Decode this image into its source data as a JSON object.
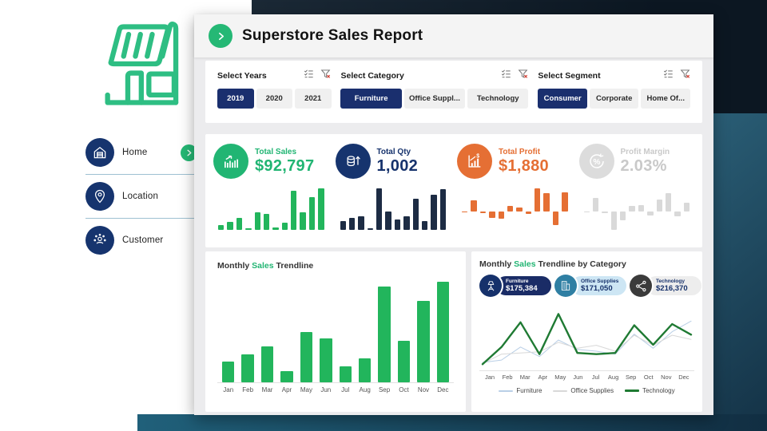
{
  "header": {
    "title": "Superstore Sales Report"
  },
  "sidebar": {
    "items": [
      {
        "label": "Home",
        "icon": "home",
        "active": true
      },
      {
        "label": "Location",
        "icon": "location",
        "active": false
      },
      {
        "label": "Customer",
        "icon": "customer",
        "active": false
      }
    ]
  },
  "filters": [
    {
      "label": "Select Years",
      "options": [
        {
          "label": "2019",
          "selected": true
        },
        {
          "label": "2020",
          "selected": false
        },
        {
          "label": "2021",
          "selected": false
        }
      ]
    },
    {
      "label": "Select Category",
      "options": [
        {
          "label": "Furniture",
          "selected": true
        },
        {
          "label": "Office Suppl...",
          "selected": false
        },
        {
          "label": "Technology",
          "selected": false
        }
      ]
    },
    {
      "label": "Select Segment",
      "options": [
        {
          "label": "Consumer",
          "selected": true
        },
        {
          "label": "Corporate",
          "selected": false
        },
        {
          "label": "Home Of...",
          "selected": false
        }
      ]
    }
  ],
  "kpis": [
    {
      "label": "Total Sales",
      "value": "$92,797",
      "icon": "trend-chart",
      "circle_color": "#21B573",
      "text_color": "#21B573",
      "spark_color": "#22B55C",
      "spark_type": "positive",
      "spark_key": "sales_spark"
    },
    {
      "label": "Total Qty",
      "value": "1,002",
      "icon": "coins",
      "circle_color": "#16346E",
      "text_color": "#16326C",
      "spark_color": "#1D2C44",
      "spark_type": "positive",
      "spark_key": "qty_spark"
    },
    {
      "label": "Total Profit",
      "value": "$1,880",
      "icon": "profit-chart",
      "circle_color": "#E56F34",
      "text_color": "#E56F34",
      "spark_color": "#E56F34",
      "spark_type": "signed",
      "spark_key": "profit_spark"
    },
    {
      "label": "Profit Margin",
      "value": "2.03%",
      "icon": "percent",
      "circle_color": "#DCDCDC",
      "text_color": "#C9C9C9",
      "spark_color": "#D9D9D9",
      "spark_type": "signed",
      "spark_key": "margin_spark"
    }
  ],
  "category_cards": [
    {
      "name": "Furniture",
      "value": "$175,384",
      "icon": "lamp",
      "circle_color": "#16316B",
      "pill_color": "#1A2C66",
      "text_color": "#FFFFFF"
    },
    {
      "name": "Office Supplies",
      "value": "$171,050",
      "icon": "building",
      "circle_color": "#2F7FA3",
      "pill_color": "#CDE6F4",
      "text_color": "#16316B"
    },
    {
      "name": "Technology",
      "value": "$216,370",
      "icon": "share",
      "circle_color": "#3B3B3B",
      "pill_color": "#EDEDED",
      "text_color": "#16316B"
    }
  ],
  "chart_data": [
    {
      "id": "sales_spark",
      "type": "bar",
      "title": "Total Sales by month (sparkline)",
      "units": "relative_0_100",
      "categories": [
        "Jan",
        "Feb",
        "Mar",
        "Apr",
        "May",
        "Jun",
        "Jul",
        "Aug",
        "Sep",
        "Oct",
        "Nov",
        "Dec"
      ],
      "values": [
        12,
        20,
        28,
        4,
        42,
        38,
        5,
        18,
        95,
        42,
        78,
        100
      ]
    },
    {
      "id": "qty_spark",
      "type": "bar",
      "title": "Total Qty by month (sparkline)",
      "units": "relative_0_100",
      "categories": [
        "Jan",
        "Feb",
        "Mar",
        "Apr",
        "May",
        "Jun",
        "Jul",
        "Aug",
        "Sep",
        "Oct",
        "Nov",
        "Dec"
      ],
      "values": [
        22,
        28,
        32,
        4,
        100,
        45,
        25,
        33,
        75,
        22,
        85,
        98
      ]
    },
    {
      "id": "profit_spark",
      "type": "bar",
      "title": "Total Profit by month (sparkline, signed)",
      "units": "relative_-100_100",
      "categories": [
        "Jan",
        "Feb",
        "Mar",
        "Apr",
        "May",
        "Jun",
        "Jul",
        "Aug",
        "Sep",
        "Oct",
        "Nov",
        "Dec"
      ],
      "values": [
        -4,
        35,
        -8,
        -28,
        -30,
        18,
        12,
        -10,
        75,
        60,
        -55,
        62
      ]
    },
    {
      "id": "margin_spark",
      "type": "bar",
      "title": "Profit Margin by month (sparkline, signed)",
      "units": "relative_-100_100",
      "categories": [
        "Jan",
        "Feb",
        "Mar",
        "Apr",
        "May",
        "Jun",
        "Jul",
        "Aug",
        "Sep",
        "Oct",
        "Nov",
        "Dec"
      ],
      "values": [
        -5,
        40,
        -8,
        -70,
        -35,
        15,
        18,
        -15,
        35,
        55,
        -20,
        25
      ]
    },
    {
      "id": "monthly_sales_trendline",
      "type": "bar",
      "title": "Monthly Sales Trendline",
      "title_prefix": "Monthly ",
      "title_accent": "Sales",
      "title_suffix": " Trendline",
      "xlabel": "Month",
      "ylabel": "Sales",
      "units": "relative_0_100",
      "grid": false,
      "categories": [
        "Jan",
        "Feb",
        "Mar",
        "Apr",
        "May",
        "Jun",
        "Jul",
        "Aug",
        "Sep",
        "Oct",
        "Nov",
        "Dec"
      ],
      "values": [
        21,
        28,
        36,
        11,
        50,
        44,
        16,
        24,
        95,
        41,
        81,
        100
      ],
      "bar_color": "#22B55C"
    },
    {
      "id": "monthly_sales_by_category",
      "type": "line",
      "title": "Monthly Sales Trendline by Category",
      "title_prefix": "Monthly ",
      "title_accent": "Sales",
      "title_suffix": " Trendline by Category",
      "xlabel": "Month",
      "ylabel": "Sales",
      "units": "relative_0_100",
      "grid": false,
      "legend_position": "bottom",
      "categories": [
        "Jan",
        "Feb",
        "Mar",
        "Apr",
        "May",
        "Jun",
        "Jul",
        "Aug",
        "Sep",
        "Oct",
        "Nov",
        "Dec"
      ],
      "series": [
        {
          "name": "Furniture",
          "color": "#B9CFE6",
          "width": 1,
          "values": [
            8,
            12,
            34,
            18,
            46,
            30,
            27,
            22,
            56,
            32,
            60,
            78
          ]
        },
        {
          "name": "Office Supplies",
          "color": "#D8D8D8",
          "width": 1,
          "values": [
            6,
            22,
            24,
            26,
            42,
            32,
            37,
            27,
            54,
            37,
            54,
            47
          ]
        },
        {
          "name": "Technology",
          "color": "#1F7A33",
          "width": 2.4,
          "values": [
            5,
            34,
            76,
            22,
            90,
            24,
            22,
            24,
            71,
            38,
            73,
            55
          ]
        }
      ]
    }
  ]
}
